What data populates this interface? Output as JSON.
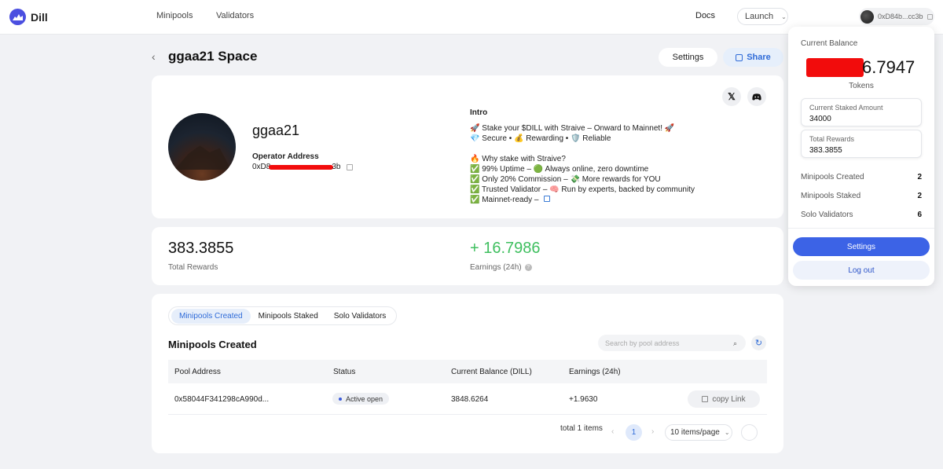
{
  "colors": {
    "accent": "#3c63e6",
    "positive": "#3fbf5f",
    "redaction": "#f20c0c",
    "page_bg": "#f1f2f5"
  },
  "nav": {
    "logo_text": "Dill",
    "links": [
      "Minipools",
      "Validators"
    ],
    "docs": "Docs",
    "launch": "Launch",
    "wallet": "0xD84b...cc3b"
  },
  "header": {
    "back_icon": "chevron-left-icon",
    "title": "ggaa21 Space",
    "settings": "Settings",
    "share": "Share"
  },
  "profile": {
    "name": "ggaa21",
    "operator_label": "Operator Address",
    "address_prefix": "0xD8",
    "address_suffix": "3b",
    "social_x": "𝕏",
    "social_discord": "discord-icon",
    "intro_title": "Intro",
    "intro_lines": [
      "🚀 Stake your $DILL with Straive – Onward to Mainnet! 🚀",
      "💎 Secure • 💰 Rewarding • 🛡️ Reliable",
      "",
      "🔥 Why stake with Straive?",
      "✅ 99% Uptime – 🟢 Always online, zero downtime",
      "✅ Only 20% Commission – 💸 More rewards for YOU",
      "✅ Trusted Validator – 🧠 Run by experts, backed by community",
      "✅ Mainnet-ready –"
    ]
  },
  "stats": {
    "total_rewards": "383.3855",
    "total_rewards_label": "Total Rewards",
    "earnings": "+ 16.7986",
    "earnings_label": "Earnings (24h)"
  },
  "table": {
    "tabs": [
      "Minipools Created",
      "Minipools Staked",
      "Solo Validators"
    ],
    "active_tab": "Minipools Created",
    "title": "Minipools Created",
    "search_placeholder": "Search by pool address",
    "columns": [
      "Pool Address",
      "Status",
      "Current Balance (DILL)",
      "Earnings (24h)"
    ],
    "rows": [
      {
        "address": "0x58044F341298cA990d...",
        "status": "Active open",
        "balance": "3848.6264",
        "earnings": "+1.9630",
        "action": "copy Link"
      }
    ],
    "pagination": {
      "total": "total 1 items",
      "page": "1",
      "page_size": "10 items/page"
    }
  },
  "panel": {
    "balance_label": "Current Balance",
    "balance_visible": "6.7947",
    "tokens": "Tokens",
    "staked_label": "Current Staked Amount",
    "staked_value": "34000",
    "rewards_label": "Total Rewards",
    "rewards_value": "383.3855",
    "rows": [
      {
        "label": "Minipools Created",
        "value": "2"
      },
      {
        "label": "Minipools Staked",
        "value": "2"
      },
      {
        "label": "Solo Validators",
        "value": "6"
      }
    ],
    "settings": "Settings",
    "logout": "Log out"
  }
}
